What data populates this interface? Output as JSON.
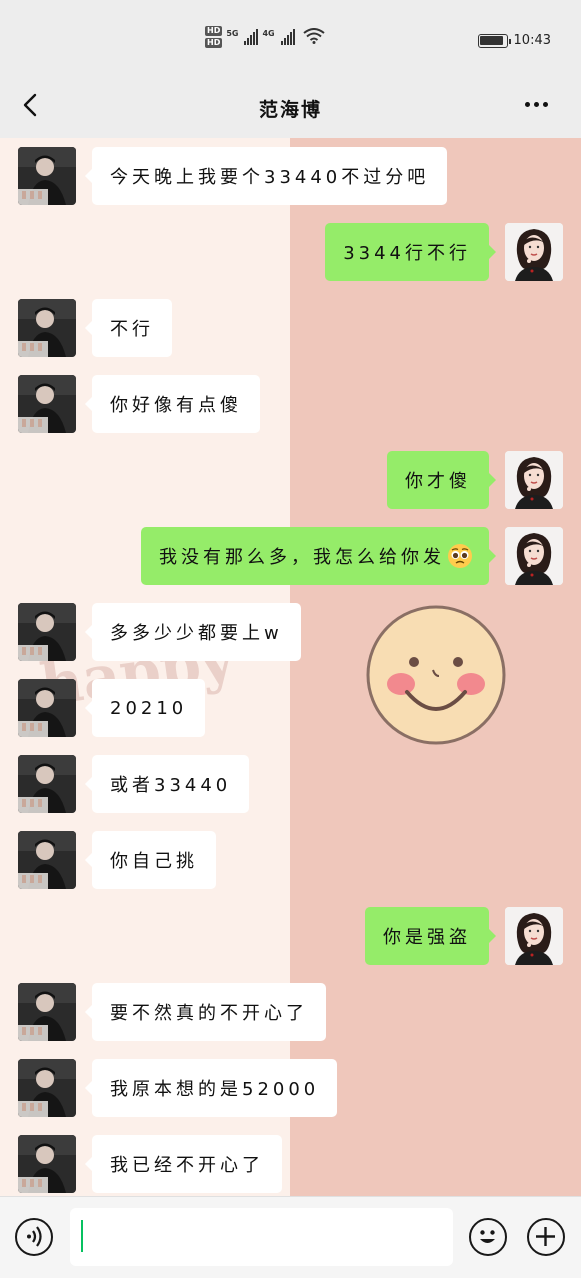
{
  "status_bar": {
    "hd1": "HD",
    "hd2": "HD",
    "net1": "5G",
    "net2": "4G",
    "time": "10:43",
    "battery_level": 0.9,
    "icons": [
      "signal-icon",
      "wifi-icon",
      "battery-icon"
    ]
  },
  "header": {
    "title": "范海博",
    "back_icon": "chevron-left-icon",
    "more_icon": "more-dots-icon"
  },
  "messages": [
    {
      "side": "in",
      "text": "今天晚上我要个33440不过分吧"
    },
    {
      "side": "out",
      "text": "3344行不行"
    },
    {
      "side": "in",
      "text": "不行"
    },
    {
      "side": "in",
      "text": "你好像有点傻"
    },
    {
      "side": "out",
      "text": "你才傻"
    },
    {
      "side": "out",
      "text": "我没有那么多，我怎么给你发",
      "emoji": "pleading-face-emoji"
    },
    {
      "side": "in",
      "text": "多多少少都要上w"
    },
    {
      "side": "in",
      "text": "20210"
    },
    {
      "side": "in",
      "text": "或者33440"
    },
    {
      "side": "in",
      "text": "你自己挑"
    },
    {
      "side": "out",
      "text": "你是强盗"
    },
    {
      "side": "in",
      "text": "要不然真的不开心了"
    },
    {
      "side": "in",
      "text": "我原本想的是52000"
    },
    {
      "side": "in",
      "text": "我已经不开心了"
    }
  ],
  "background": {
    "watermark": "happy",
    "left_color": "#fcf0ea",
    "right_color": "#efc7bb",
    "decoration": "smiley-face-icon"
  },
  "input_bar": {
    "placeholder": "",
    "value": "",
    "voice_icon": "voice-icon",
    "emoji_icon": "emoji-icon",
    "plus_icon": "plus-icon"
  },
  "colors": {
    "outgoing_bubble": "#95ec69",
    "incoming_bubble": "#ffffff",
    "caret": "#07c160"
  }
}
